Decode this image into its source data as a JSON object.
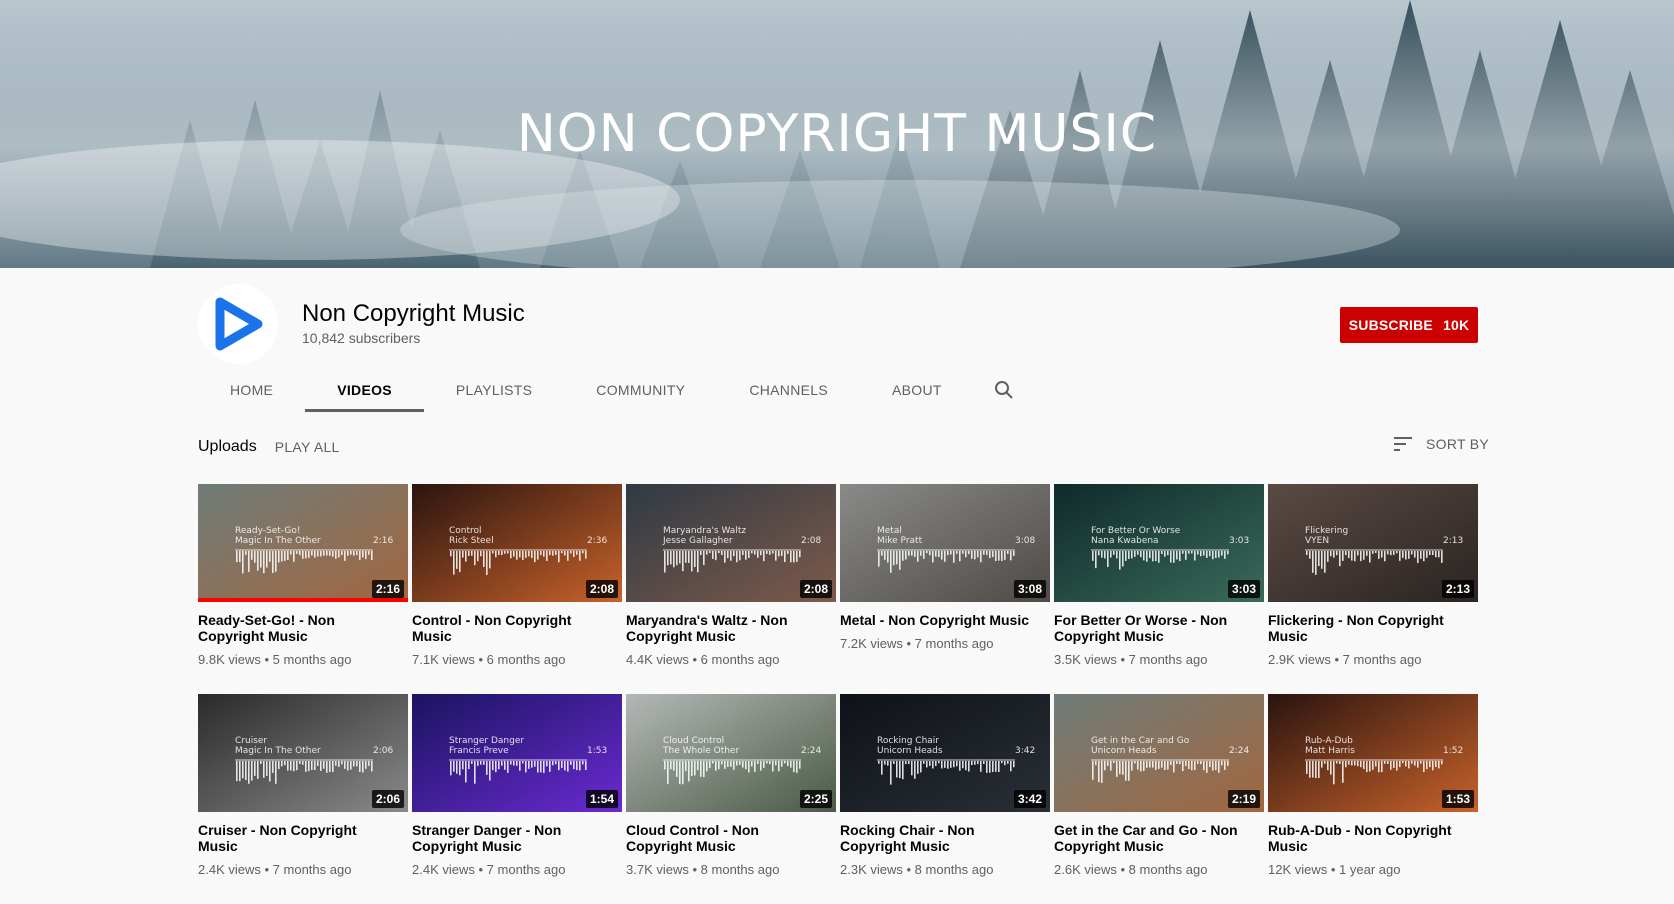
{
  "banner": {
    "title": "NON COPYRIGHT MUSIC"
  },
  "channel": {
    "name": "Non Copyright Music",
    "subscribers": "10,842 subscribers"
  },
  "subscribe": {
    "label": "SUBSCRIBE",
    "count": "10K"
  },
  "tabs": [
    {
      "label": "HOME"
    },
    {
      "label": "VIDEOS"
    },
    {
      "label": "PLAYLISTS"
    },
    {
      "label": "COMMUNITY"
    },
    {
      "label": "CHANNELS"
    },
    {
      "label": "ABOUT"
    }
  ],
  "section": {
    "title": "Uploads",
    "play_all": "PLAY ALL",
    "sort_by": "SORT BY"
  },
  "videos": [
    {
      "title": "Ready-Set-Go! - Non Copyright Music",
      "views": "9.8K views",
      "age": "5 months ago",
      "duration": "2:16",
      "overlay1": "Ready-Set-Go!",
      "overlay2": "Magic In The Other",
      "overlay_dur": "2:16",
      "bg1": "#6f7d79",
      "bg2": "#a2663f",
      "watched": 1
    },
    {
      "title": "Control - Non Copyright Music",
      "views": "7.1K views",
      "age": "6 months ago",
      "duration": "2:08",
      "overlay1": "Control",
      "overlay2": "Rick Steel",
      "overlay_dur": "2:36",
      "bg1": "#2a1410",
      "bg2": "#c8622a"
    },
    {
      "title": "Maryandra's Waltz - Non Copyright Music",
      "views": "4.4K views",
      "age": "6 months ago",
      "duration": "2:08",
      "overlay1": "Maryandra's Waltz",
      "overlay2": "Jesse Gallagher",
      "overlay_dur": "2:08",
      "bg1": "#2f3a44",
      "bg2": "#7e5a4a"
    },
    {
      "title": "Metal - Non Copyright Music",
      "views": "7.2K views",
      "age": "7 months ago",
      "duration": "3:08",
      "overlay1": "Metal",
      "overlay2": "Mike Pratt",
      "overlay_dur": "3:08",
      "bg1": "#8a8a88",
      "bg2": "#4e4a46"
    },
    {
      "title": "For Better Or Worse - Non Copyright Music",
      "views": "3.5K views",
      "age": "7 months ago",
      "duration": "3:03",
      "overlay1": "For Better Or Worse",
      "overlay2": "Nana Kwabena",
      "overlay_dur": "3:03",
      "bg1": "#0f2a2a",
      "bg2": "#3a6a5a"
    },
    {
      "title": "Flickering - Non Copyright Music",
      "views": "2.9K views",
      "age": "7 months ago",
      "duration": "2:13",
      "overlay1": "Flickering",
      "overlay2": "VYEN",
      "overlay_dur": "2:13",
      "bg1": "#5a4a44",
      "bg2": "#2a2422"
    },
    {
      "title": "Cruiser - Non Copyright Music",
      "views": "2.4K views",
      "age": "7 months ago",
      "duration": "2:06",
      "overlay1": "Cruiser",
      "overlay2": "Magic In The Other",
      "overlay_dur": "2:06",
      "bg1": "#2a2a2a",
      "bg2": "#8a8a8a"
    },
    {
      "title": "Stranger Danger - Non Copyright Music",
      "views": "2.4K views",
      "age": "7 months ago",
      "duration": "1:54",
      "overlay1": "Stranger Danger",
      "overlay2": "Francis Preve",
      "overlay_dur": "1:53",
      "bg1": "#1a1460",
      "bg2": "#6a2ad0"
    },
    {
      "title": "Cloud Control - Non Copyright Music",
      "views": "3.7K views",
      "age": "8 months ago",
      "duration": "2:25",
      "overlay1": "Cloud Control",
      "overlay2": "The Whole Other",
      "overlay_dur": "2:24",
      "bg1": "#b4b8b6",
      "bg2": "#4a5a46"
    },
    {
      "title": "Rocking Chair - Non Copyright Music",
      "views": "2.3K views",
      "age": "8 months ago",
      "duration": "3:42",
      "overlay1": "Rocking Chair",
      "overlay2": "Unicorn Heads",
      "overlay_dur": "3:42",
      "bg1": "#0e1218",
      "bg2": "#2a2e36"
    },
    {
      "title": "Get in the Car and Go - Non Copyright Music",
      "views": "2.6K views",
      "age": "8 months ago",
      "duration": "2:19",
      "overlay1": "Get in the Car and Go",
      "overlay2": "Unicorn Heads",
      "overlay_dur": "2:24",
      "bg1": "#6f7d79",
      "bg2": "#a2663f"
    },
    {
      "title": "Rub-A-Dub - Non Copyright Music",
      "views": "12K views",
      "age": "1 year ago",
      "duration": "1:53",
      "overlay1": "Rub-A-Dub",
      "overlay2": "Matt Harris",
      "overlay_dur": "1:52",
      "bg1": "#2a1410",
      "bg2": "#c8622a"
    }
  ],
  "colors": {
    "subscribe": "#cc0000",
    "logo_blue": "#1a73e8",
    "progress": "#ff0000"
  },
  "icons": {
    "search": "search-icon",
    "sort": "sort-icon",
    "logo": "play-logo-icon"
  }
}
